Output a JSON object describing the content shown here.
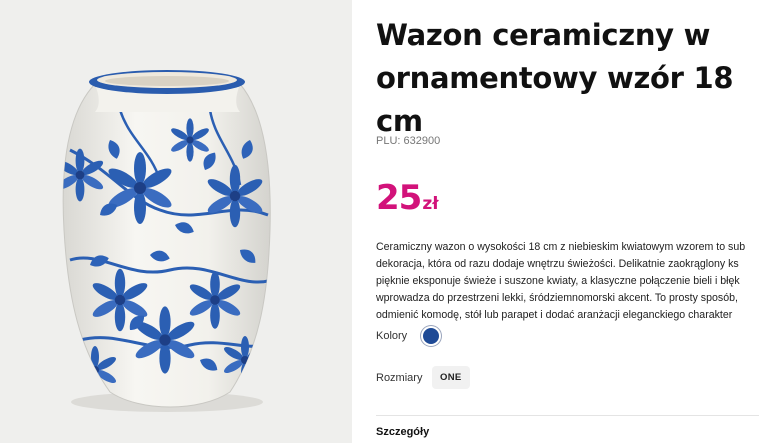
{
  "product": {
    "image_alt": "vase-photo",
    "title_lines": [
      "Wazon ceramiczny w",
      "ornamentowy wzór 18",
      "cm"
    ],
    "plu": "PLU: 632900",
    "price": {
      "amount": "25",
      "currency": "zł",
      "color": "#d2127a"
    },
    "description_lines": [
      "Ceramiczny wazon o wysokości 18 cm z niebieskim kwiatowym wzorem to sub",
      "dekoracja, która od razu dodaje wnętrzu świeżości. Delikatnie zaokrąglony ks",
      "pięknie eksponuje świeże i suszone kwiaty, a klasyczne połączenie bieli i błęk",
      "wprowadza do przestrzeni lekki, śródziemnomorski akcent. To prosty sposób,",
      "odmienić komodę, stół lub parapet i dodać aranżacji eleganckiego charakter"
    ],
    "colors": {
      "label": "Kolory",
      "options": [
        {
          "name": "navy-blue",
          "hex": "#1e4a96"
        }
      ]
    },
    "sizes": {
      "label": "Rozmiary",
      "options": [
        "ONE"
      ]
    },
    "details_label": "Szczegóły"
  }
}
